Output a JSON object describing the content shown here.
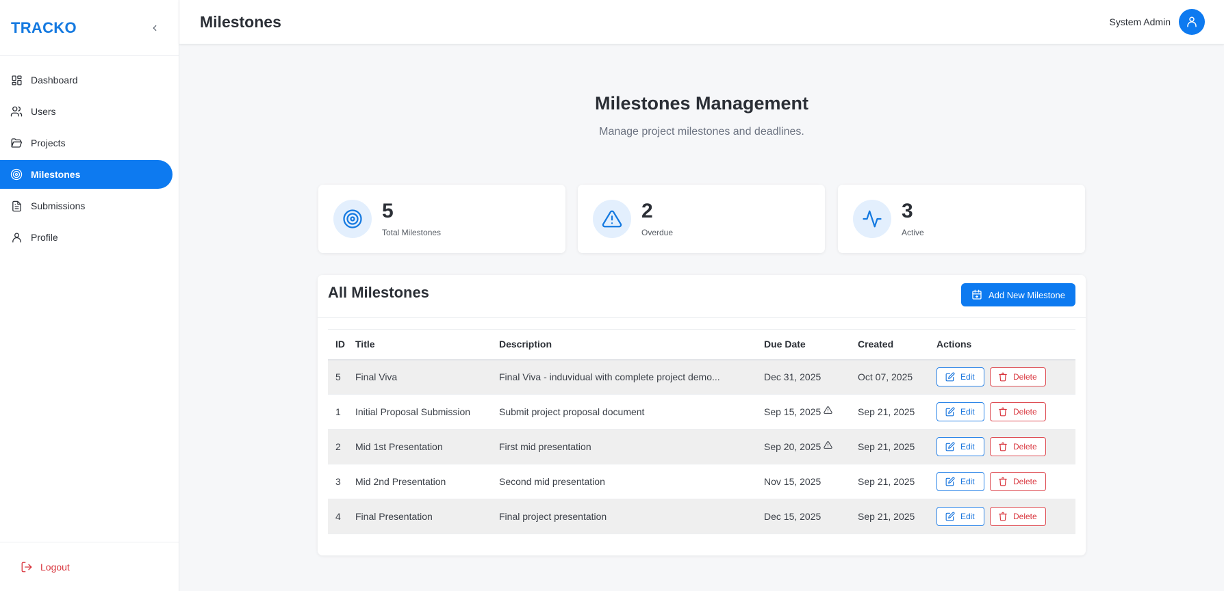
{
  "brand": "TRACKO",
  "sidebar": {
    "items": [
      {
        "label": "Dashboard",
        "icon": "dashboard-icon"
      },
      {
        "label": "Users",
        "icon": "users-icon"
      },
      {
        "label": "Projects",
        "icon": "folder-icon"
      },
      {
        "label": "Milestones",
        "icon": "target-icon",
        "active": true
      },
      {
        "label": "Submissions",
        "icon": "file-icon"
      },
      {
        "label": "Profile",
        "icon": "user-icon"
      }
    ],
    "logout": "Logout"
  },
  "header": {
    "title": "Milestones",
    "user_name": "System Admin"
  },
  "hero": {
    "title": "Milestones Management",
    "subtitle": "Manage project milestones and deadlines."
  },
  "stats": [
    {
      "value": "5",
      "label": "Total Milestones",
      "icon": "target-icon"
    },
    {
      "value": "2",
      "label": "Overdue",
      "icon": "warning-icon"
    },
    {
      "value": "3",
      "label": "Active",
      "icon": "activity-icon"
    }
  ],
  "table": {
    "title": "All Milestones",
    "add_label": "Add New Milestone",
    "columns": [
      "ID",
      "Title",
      "Description",
      "Due Date",
      "Created",
      "Actions"
    ],
    "edit_label": "Edit",
    "delete_label": "Delete",
    "rows": [
      {
        "id": "5",
        "title": "Final Viva",
        "description": "Final Viva - induvidual with complete project demo...",
        "due": "Dec 31, 2025",
        "overdue": false,
        "created": "Oct 07, 2025"
      },
      {
        "id": "1",
        "title": "Initial Proposal Submission",
        "description": "Submit project proposal document",
        "due": "Sep 15, 2025",
        "overdue": true,
        "created": "Sep 21, 2025"
      },
      {
        "id": "2",
        "title": "Mid 1st Presentation",
        "description": "First mid presentation",
        "due": "Sep 20, 2025",
        "overdue": true,
        "created": "Sep 21, 2025"
      },
      {
        "id": "3",
        "title": "Mid 2nd Presentation",
        "description": "Second mid presentation",
        "due": "Nov 15, 2025",
        "overdue": false,
        "created": "Sep 21, 2025"
      },
      {
        "id": "4",
        "title": "Final Presentation",
        "description": "Final project presentation",
        "due": "Dec 15, 2025",
        "overdue": false,
        "created": "Sep 21, 2025"
      }
    ]
  },
  "colors": {
    "primary": "#0d7af0",
    "danger": "#d9363e",
    "background": "#f6f7f9"
  }
}
